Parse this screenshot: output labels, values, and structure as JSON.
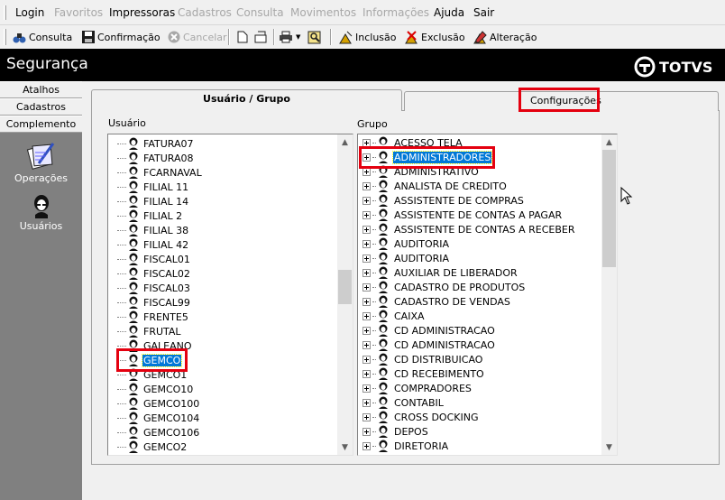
{
  "menu": [
    "Login",
    "Favoritos",
    "Impressoras",
    "Cadastros",
    "Consulta",
    "Movimentos",
    "Informações",
    "Ajuda",
    "Sair"
  ],
  "menu_disabled": [
    false,
    true,
    false,
    true,
    true,
    true,
    true,
    false,
    false
  ],
  "toolbar": {
    "consulta": "Consulta",
    "confirmacao": "Confirmação",
    "cancelar": "Cancelar",
    "inclusao": "Inclusão",
    "exclusao": "Exclusão",
    "alteracao": "Alteração"
  },
  "header": {
    "title": "Segurança",
    "logo_text": "TOTVS"
  },
  "sidebar": {
    "tabs": [
      "Atalhos",
      "Cadastros",
      "Complemento"
    ],
    "items": [
      "Operações",
      "Usuários"
    ]
  },
  "tabs": {
    "user_group": "Usuário  / Grupo",
    "config": "Configurações"
  },
  "labels": {
    "usuario": "Usuário",
    "grupo": "Grupo"
  },
  "users": [
    "FATURA07",
    "FATURA08",
    "FCARNAVAL",
    "FILIAL 11",
    "FILIAL 14",
    "FILIAL 2",
    "FILIAL 38",
    "FILIAL 42",
    "FISCAL01",
    "FISCAL02",
    "FISCAL03",
    "FISCAL99",
    "FRENTE5",
    "FRUTAL",
    "GALEANO",
    "GEMCO",
    "GEMCO1",
    "GEMCO10",
    "GEMCO100",
    "GEMCO104",
    "GEMCO106",
    "GEMCO2"
  ],
  "selected_user": "GEMCO",
  "groups": [
    "ACESSO TELA",
    "ADMINISTRADORES",
    "ADMINISTRATIVO",
    "ANALISTA DE CREDITO",
    "ASSISTENTE DE COMPRAS",
    "ASSISTENTE DE CONTAS A PAGAR",
    "ASSISTENTE DE CONTAS A RECEBER",
    "AUDITORIA",
    "AUDITORIA",
    "AUXILIAR DE LIBERADOR",
    "CADASTRO DE PRODUTOS",
    "CADASTRO DE VENDAS",
    "CAIXA",
    "CD ADMINISTRACAO",
    "CD ADMINISTRACAO",
    "CD DISTRIBUICAO",
    "CD RECEBIMENTO",
    "COMPRADORES",
    "CONTABIL",
    "CROSS DOCKING",
    "DEPOS",
    "DIRETORIA"
  ],
  "selected_group": "ADMINISTRADORES",
  "colors": {
    "selection": "#0078d7",
    "highlight": "#e4000f",
    "header": "#000000",
    "sidebar": "#808080"
  }
}
